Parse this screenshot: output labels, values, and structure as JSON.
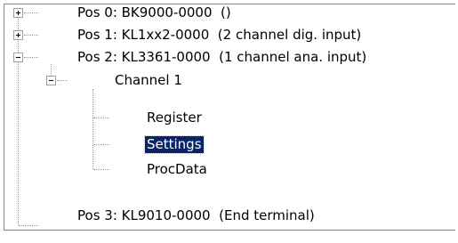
{
  "tree": {
    "pos0": {
      "label": "Pos 0: BK9000-0000  ()",
      "expanded": false
    },
    "pos1": {
      "label": "Pos 1: KL1xx2-0000  (2 channel dig. input)",
      "expanded": false
    },
    "pos2": {
      "label": "Pos 2: KL3361-0000  (1 channel ana. input)",
      "expanded": true,
      "channel1": {
        "label": "Channel 1",
        "expanded": true,
        "children": [
          "Register",
          "Settings",
          "ProcData"
        ]
      }
    },
    "pos3": {
      "label": "Pos 3: KL9010-0000  (End terminal)"
    },
    "selected": "Settings",
    "selection_color": "#0a246a"
  }
}
